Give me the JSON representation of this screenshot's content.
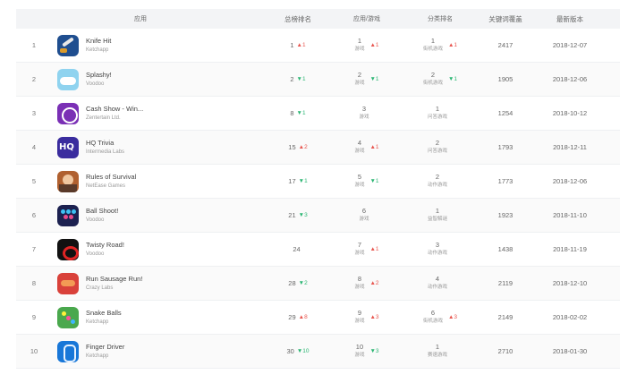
{
  "header": {
    "app": "应用",
    "total_rank": "总榜排名",
    "app_game": "应用/游戏",
    "category_rank": "分类排名",
    "keywords": "关键词覆盖",
    "latest_version": "最新版本"
  },
  "rows": [
    {
      "rank": "1",
      "name": "Knife Hit",
      "dev": "Ketchapp",
      "icon": "knife-icon",
      "total": "1",
      "total_trend": "▲1",
      "total_dir": "up",
      "app_rank": "1",
      "app_sub": "游戏",
      "app_trend": "▲1",
      "app_dir": "up",
      "cat_rank": "1",
      "cat_sub": "街机游戏",
      "cat_trend": "▲1",
      "cat_dir": "up",
      "keywords": "2417",
      "version": "2018-12-07"
    },
    {
      "rank": "2",
      "name": "Splashy!",
      "dev": "Voodoo",
      "icon": "splashy-icon",
      "total": "2",
      "total_trend": "▼1",
      "total_dir": "down",
      "app_rank": "2",
      "app_sub": "游戏",
      "app_trend": "▼1",
      "app_dir": "down",
      "cat_rank": "2",
      "cat_sub": "街机游戏",
      "cat_trend": "▼1",
      "cat_dir": "down",
      "keywords": "1905",
      "version": "2018-12-06"
    },
    {
      "rank": "3",
      "name": "Cash Show - Win...",
      "dev": "Zentertain Ltd.",
      "icon": "cash-show-icon",
      "total": "8",
      "total_trend": "▼1",
      "total_dir": "down",
      "app_rank": "3",
      "app_sub": "游戏",
      "app_trend": "",
      "app_dir": "",
      "cat_rank": "1",
      "cat_sub": "问答游戏",
      "cat_trend": "",
      "cat_dir": "",
      "keywords": "1254",
      "version": "2018-10-12"
    },
    {
      "rank": "4",
      "name": "HQ Trivia",
      "dev": "Intermedia Labs",
      "icon": "hq-trivia-icon",
      "total": "15",
      "total_trend": "▲2",
      "total_dir": "up",
      "app_rank": "4",
      "app_sub": "游戏",
      "app_trend": "▲1",
      "app_dir": "up",
      "cat_rank": "2",
      "cat_sub": "问答游戏",
      "cat_trend": "",
      "cat_dir": "",
      "keywords": "1793",
      "version": "2018-12-11"
    },
    {
      "rank": "5",
      "name": "Rules of Survival",
      "dev": "NetEase Games",
      "icon": "rules-of-survival-icon",
      "total": "17",
      "total_trend": "▼1",
      "total_dir": "down",
      "app_rank": "5",
      "app_sub": "游戏",
      "app_trend": "▼1",
      "app_dir": "down",
      "cat_rank": "2",
      "cat_sub": "动作游戏",
      "cat_trend": "",
      "cat_dir": "",
      "keywords": "1773",
      "version": "2018-12-06"
    },
    {
      "rank": "6",
      "name": "Ball Shoot!",
      "dev": "Voodoo",
      "icon": "ball-shoot-icon",
      "total": "21",
      "total_trend": "▼3",
      "total_dir": "down",
      "app_rank": "6",
      "app_sub": "游戏",
      "app_trend": "",
      "app_dir": "",
      "cat_rank": "1",
      "cat_sub": "益智解谜",
      "cat_trend": "",
      "cat_dir": "",
      "keywords": "1923",
      "version": "2018-11-10"
    },
    {
      "rank": "7",
      "name": "Twisty Road!",
      "dev": "Voodoo",
      "icon": "twisty-road-icon",
      "total": "24",
      "total_trend": "",
      "total_dir": "",
      "app_rank": "7",
      "app_sub": "游戏",
      "app_trend": "▲1",
      "app_dir": "up",
      "cat_rank": "3",
      "cat_sub": "动作游戏",
      "cat_trend": "",
      "cat_dir": "",
      "keywords": "1438",
      "version": "2018-11-19"
    },
    {
      "rank": "8",
      "name": "Run Sausage Run!",
      "dev": "Crazy Labs",
      "icon": "run-sausage-run-icon",
      "total": "28",
      "total_trend": "▼2",
      "total_dir": "down",
      "app_rank": "8",
      "app_sub": "游戏",
      "app_trend": "▲2",
      "app_dir": "up",
      "cat_rank": "4",
      "cat_sub": "动作游戏",
      "cat_trend": "",
      "cat_dir": "",
      "keywords": "2119",
      "version": "2018-12-10"
    },
    {
      "rank": "9",
      "name": "Snake Balls",
      "dev": "Ketchapp",
      "icon": "snake-balls-icon",
      "total": "29",
      "total_trend": "▲8",
      "total_dir": "up",
      "app_rank": "9",
      "app_sub": "游戏",
      "app_trend": "▲3",
      "app_dir": "up",
      "cat_rank": "6",
      "cat_sub": "街机游戏",
      "cat_trend": "▲3",
      "cat_dir": "up",
      "keywords": "2149",
      "version": "2018-02-02"
    },
    {
      "rank": "10",
      "name": "Finger Driver",
      "dev": "Ketchapp",
      "icon": "finger-driver-icon",
      "total": "30",
      "total_trend": "▼10",
      "total_dir": "down",
      "app_rank": "10",
      "app_sub": "游戏",
      "app_trend": "▼3",
      "app_dir": "down",
      "cat_rank": "1",
      "cat_sub": "赛速游戏",
      "cat_trend": "",
      "cat_dir": "",
      "keywords": "2710",
      "version": "2018-01-30"
    }
  ]
}
